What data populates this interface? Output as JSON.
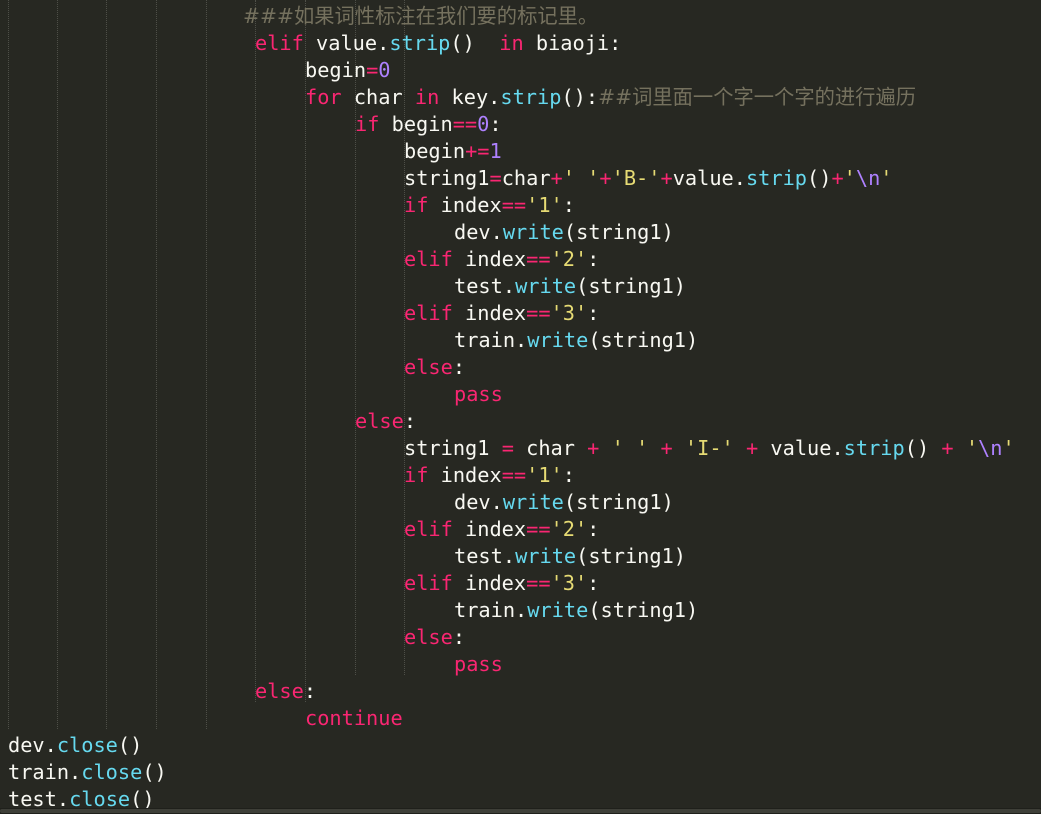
{
  "editor": {
    "lines": [
      [
        [
          "c",
          "###如果词性标注在我们要的标记里。"
        ]
      ],
      [
        [
          "k",
          "elif"
        ],
        [
          "t",
          " value."
        ],
        [
          "f",
          "strip"
        ],
        [
          "t",
          "()  "
        ],
        [
          "k",
          "in"
        ],
        [
          "t",
          " biaoji:"
        ]
      ],
      [
        [
          "t",
          "begin"
        ],
        [
          "k",
          "="
        ],
        [
          "n",
          "0"
        ]
      ],
      [
        [
          "k",
          "for"
        ],
        [
          "t",
          " char "
        ],
        [
          "k",
          "in"
        ],
        [
          "t",
          " key."
        ],
        [
          "f",
          "strip"
        ],
        [
          "t",
          "():"
        ],
        [
          "c",
          "##词里面一个字一个字的进行遍历"
        ]
      ],
      [
        [
          "k",
          "if"
        ],
        [
          "t",
          " begin"
        ],
        [
          "k",
          "=="
        ],
        [
          "n",
          "0"
        ],
        [
          "t",
          ":"
        ]
      ],
      [
        [
          "t",
          "begin"
        ],
        [
          "k",
          "+="
        ],
        [
          "n",
          "1"
        ]
      ],
      [
        [
          "t",
          "string1"
        ],
        [
          "k",
          "="
        ],
        [
          "t",
          "char"
        ],
        [
          "k",
          "+"
        ],
        [
          "s",
          "' '"
        ],
        [
          "k",
          "+"
        ],
        [
          "s",
          "'B-'"
        ],
        [
          "k",
          "+"
        ],
        [
          "t",
          "value."
        ],
        [
          "f",
          "strip"
        ],
        [
          "t",
          "()"
        ],
        [
          "k",
          "+"
        ],
        [
          "s",
          "'"
        ],
        [
          "n",
          "\\n"
        ],
        [
          "s",
          "'"
        ]
      ],
      [
        [
          "k",
          "if"
        ],
        [
          "t",
          " index"
        ],
        [
          "k",
          "=="
        ],
        [
          "s",
          "'1'"
        ],
        [
          "t",
          ":"
        ]
      ],
      [
        [
          "t",
          "dev."
        ],
        [
          "f",
          "write"
        ],
        [
          "t",
          "(string1)"
        ]
      ],
      [
        [
          "k",
          "elif"
        ],
        [
          "t",
          " index"
        ],
        [
          "k",
          "=="
        ],
        [
          "s",
          "'2'"
        ],
        [
          "t",
          ":"
        ]
      ],
      [
        [
          "t",
          "test."
        ],
        [
          "f",
          "write"
        ],
        [
          "t",
          "(string1)"
        ]
      ],
      [
        [
          "k",
          "elif"
        ],
        [
          "t",
          " index"
        ],
        [
          "k",
          "=="
        ],
        [
          "s",
          "'3'"
        ],
        [
          "t",
          ":"
        ]
      ],
      [
        [
          "t",
          "train."
        ],
        [
          "f",
          "write"
        ],
        [
          "t",
          "(string1)"
        ]
      ],
      [
        [
          "k",
          "else"
        ],
        [
          "t",
          ":"
        ]
      ],
      [
        [
          "k",
          "pass"
        ]
      ],
      [
        [
          "k",
          "else"
        ],
        [
          "t",
          ":"
        ]
      ],
      [
        [
          "t",
          "string1 "
        ],
        [
          "k",
          "="
        ],
        [
          "t",
          " char "
        ],
        [
          "k",
          "+"
        ],
        [
          "t",
          " "
        ],
        [
          "s",
          "' '"
        ],
        [
          "t",
          " "
        ],
        [
          "k",
          "+"
        ],
        [
          "t",
          " "
        ],
        [
          "s",
          "'I-'"
        ],
        [
          "t",
          " "
        ],
        [
          "k",
          "+"
        ],
        [
          "t",
          " value."
        ],
        [
          "f",
          "strip"
        ],
        [
          "t",
          "() "
        ],
        [
          "k",
          "+"
        ],
        [
          "t",
          " "
        ],
        [
          "s",
          "'"
        ],
        [
          "n",
          "\\n"
        ],
        [
          "s",
          "'"
        ]
      ],
      [
        [
          "k",
          "if"
        ],
        [
          "t",
          " index"
        ],
        [
          "k",
          "=="
        ],
        [
          "s",
          "'1'"
        ],
        [
          "t",
          ":"
        ]
      ],
      [
        [
          "t",
          "dev."
        ],
        [
          "f",
          "write"
        ],
        [
          "t",
          "(string1)"
        ]
      ],
      [
        [
          "k",
          "elif"
        ],
        [
          "t",
          " index"
        ],
        [
          "k",
          "=="
        ],
        [
          "s",
          "'2'"
        ],
        [
          "t",
          ":"
        ]
      ],
      [
        [
          "t",
          "test."
        ],
        [
          "f",
          "write"
        ],
        [
          "t",
          "(string1)"
        ]
      ],
      [
        [
          "k",
          "elif"
        ],
        [
          "t",
          " index"
        ],
        [
          "k",
          "=="
        ],
        [
          "s",
          "'3'"
        ],
        [
          "t",
          ":"
        ]
      ],
      [
        [
          "t",
          "train."
        ],
        [
          "f",
          "write"
        ],
        [
          "t",
          "(string1)"
        ]
      ],
      [
        [
          "k",
          "else"
        ],
        [
          "t",
          ":"
        ]
      ],
      [
        [
          "k",
          "pass"
        ]
      ],
      [
        [
          "k",
          "else"
        ],
        [
          "t",
          ":"
        ]
      ],
      [
        [
          "k",
          "continue"
        ]
      ],
      [
        [
          "t",
          "dev."
        ],
        [
          "f",
          "close"
        ],
        [
          "t",
          "()"
        ]
      ],
      [
        [
          "t",
          "train."
        ],
        [
          "f",
          "close"
        ],
        [
          "t",
          "()"
        ]
      ],
      [
        [
          "t",
          "test."
        ],
        [
          "f",
          "close"
        ],
        [
          "t",
          "()"
        ]
      ]
    ]
  },
  "colors": {
    "background": "#272822",
    "keyword": "#f92672",
    "string": "#e6db74",
    "number": "#ae81ff",
    "builtin": "#66d9ef",
    "comment": "#75715e",
    "text": "#f8f8f2"
  }
}
